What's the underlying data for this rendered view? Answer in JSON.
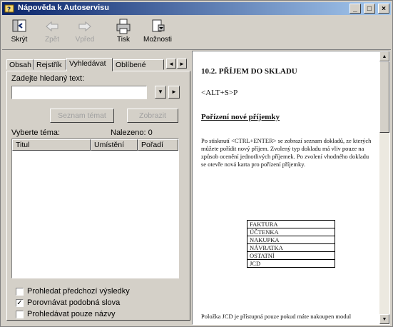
{
  "window": {
    "title": "Nápověda k Autoservisu",
    "controls": {
      "minimize": "_",
      "maximize": "□",
      "close": "×"
    }
  },
  "toolbar": {
    "hide": "Skrýt",
    "back": "Zpět",
    "forward": "Vpřed",
    "print": "Tisk",
    "options": "Možnosti"
  },
  "nav": {
    "tabs": [
      "Obsah",
      "Rejstřík",
      "Vyhledávat",
      "Oblíbené"
    ],
    "active_tab": "Vyhledávat",
    "keyword_label": "Zadejte hledaný text:",
    "keyword_value": "",
    "list_topics_button": "Seznam témat",
    "display_button": "Zobrazit",
    "select_topic_label": "Vyberte téma:",
    "found_label": "Nalezeno: 0",
    "columns": [
      "Titul",
      "Umístění",
      "Pořadí"
    ],
    "checkboxes": [
      {
        "label": "Prohledat předchozí výsledky",
        "checked": false
      },
      {
        "label": "Porovnávat podobná slova",
        "checked": true
      },
      {
        "label": "Prohledávat pouze názvy",
        "checked": false
      }
    ]
  },
  "content": {
    "heading": "10.2. PŘÍJEM DO SKLADU",
    "hotkey": "<ALT+S>P",
    "subheading": "Pořízení nové příjemky",
    "paragraph": "Po stisknutí <CTRL+ENTER> se zobrazí seznam dokladů, ze kterých můžete pořídit nový příjem. Zvolený typ dokladu má vliv pouze na způsob ocenění jednotlivých příjemek. Po zvolení vhodného dokladu se otevře nová karta pro pořízení příjemky.",
    "table_rows": [
      "FAKTURA",
      "ÚČTENKA",
      "NAKUPKA",
      "NÁVRATKA",
      "OSTATNÍ",
      "JCD"
    ],
    "footer_text": "Položka JCD je přístupná pouze pokud máte nakoupen modul"
  }
}
